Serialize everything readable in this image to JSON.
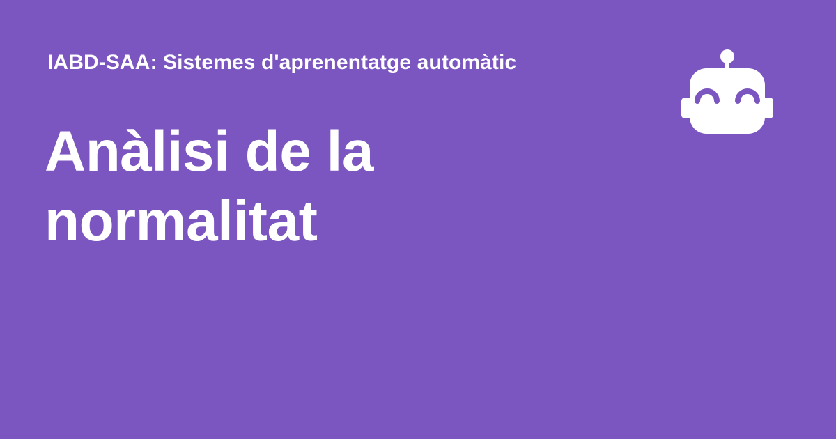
{
  "header": {
    "site_name": "IABD-SAA: Sistemes d'aprenentatge automàtic",
    "logo_icon": "robot-head-icon"
  },
  "main": {
    "title_lines": [
      "Anàlisi de la",
      "normalitat"
    ]
  },
  "colors": {
    "background": "#7c56c0",
    "text": "#ffffff"
  }
}
